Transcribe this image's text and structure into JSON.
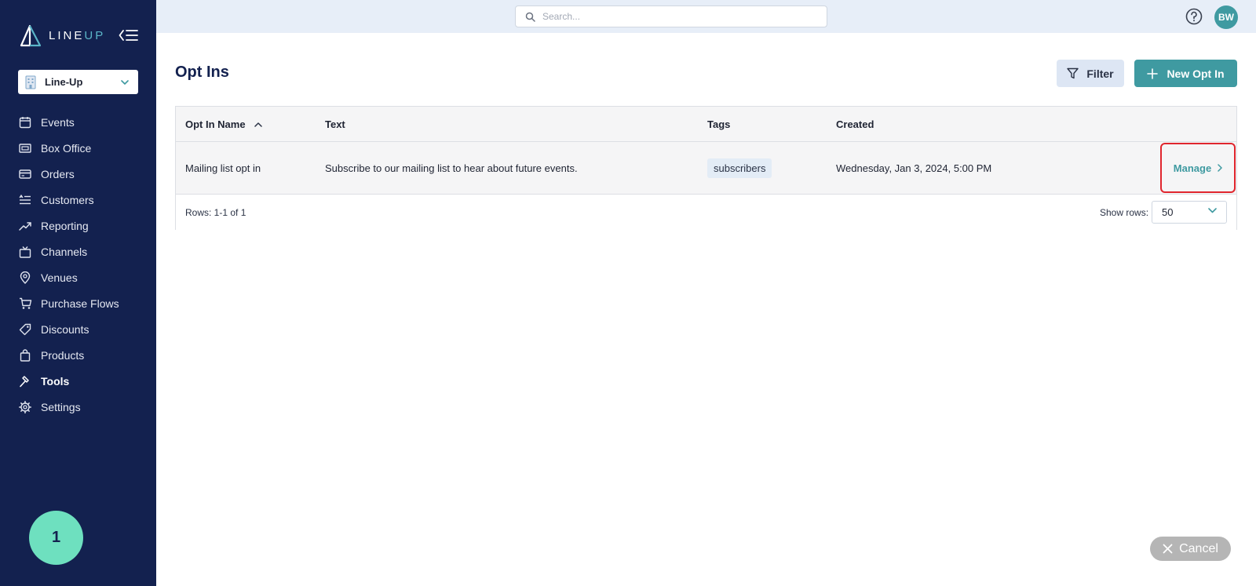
{
  "brand": {
    "logo_part1": "LINE",
    "logo_part2": "UP"
  },
  "org_selector": {
    "value": "Line-Up"
  },
  "sidebar": {
    "items": [
      {
        "label": "Events",
        "icon": "calendar-icon"
      },
      {
        "label": "Box Office",
        "icon": "ticket-icon"
      },
      {
        "label": "Orders",
        "icon": "credit-card-icon"
      },
      {
        "label": "Customers",
        "icon": "customers-list-icon"
      },
      {
        "label": "Reporting",
        "icon": "trend-chart-icon"
      },
      {
        "label": "Channels",
        "icon": "tv-icon"
      },
      {
        "label": "Venues",
        "icon": "map-pin-icon"
      },
      {
        "label": "Purchase Flows",
        "icon": "cart-icon"
      },
      {
        "label": "Discounts",
        "icon": "tag-icon"
      },
      {
        "label": "Products",
        "icon": "shopping-bag-icon"
      },
      {
        "label": "Tools",
        "icon": "hammer-icon",
        "active": true
      },
      {
        "label": "Settings",
        "icon": "gear-icon"
      }
    ]
  },
  "step_badge": "1",
  "search": {
    "placeholder": "Search...",
    "value": ""
  },
  "user": {
    "initials": "BW"
  },
  "page": {
    "title": "Opt Ins"
  },
  "toolbar": {
    "filter_label": "Filter",
    "new_label": "New Opt In"
  },
  "table": {
    "columns": [
      "Opt In Name",
      "Text",
      "Tags",
      "Created"
    ],
    "rows": [
      {
        "name": "Mailing list opt in",
        "text": "Subscribe to our mailing list to hear about future events.",
        "tag": "subscribers",
        "created": "Wednesday, Jan 3, 2024, 5:00 PM",
        "action": "Manage"
      }
    ],
    "rows_info": "Rows: 1-1 of 1",
    "show_rows_label": "Show rows:",
    "show_rows_value": "50"
  },
  "cancel": {
    "label": "Cancel"
  },
  "colors": {
    "sidebar": "#13214f",
    "accent": "#3f9aa1",
    "highlight": "#e0262e",
    "badge": "#6ee0bf"
  }
}
